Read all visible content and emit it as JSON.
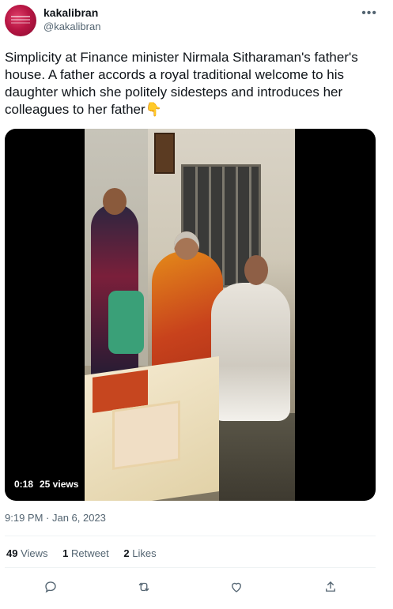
{
  "author": {
    "name": "kakalibran",
    "handle": "@kakalibran"
  },
  "tweet": {
    "text": "Simplicity at Finance minister Nirmala Sitharaman's father's house. A father accords a royal traditional welcome to his daughter which she politely sidesteps and introduces her colleagues to her father👇"
  },
  "video": {
    "duration": "0:18",
    "views": "25 views"
  },
  "timestamp": "9:19 PM · Jan 6, 2023",
  "stats": {
    "views_count": "49",
    "views_label": "Views",
    "retweets_count": "1",
    "retweets_label": "Retweet",
    "likes_count": "2",
    "likes_label": "Likes"
  },
  "icons": {
    "more": "more-icon",
    "reply": "reply-icon",
    "retweet": "retweet-icon",
    "like": "like-icon",
    "share": "share-icon"
  },
  "colors": {
    "text": "#0f1419",
    "secondary": "#536471",
    "avatar": "#b81644"
  }
}
